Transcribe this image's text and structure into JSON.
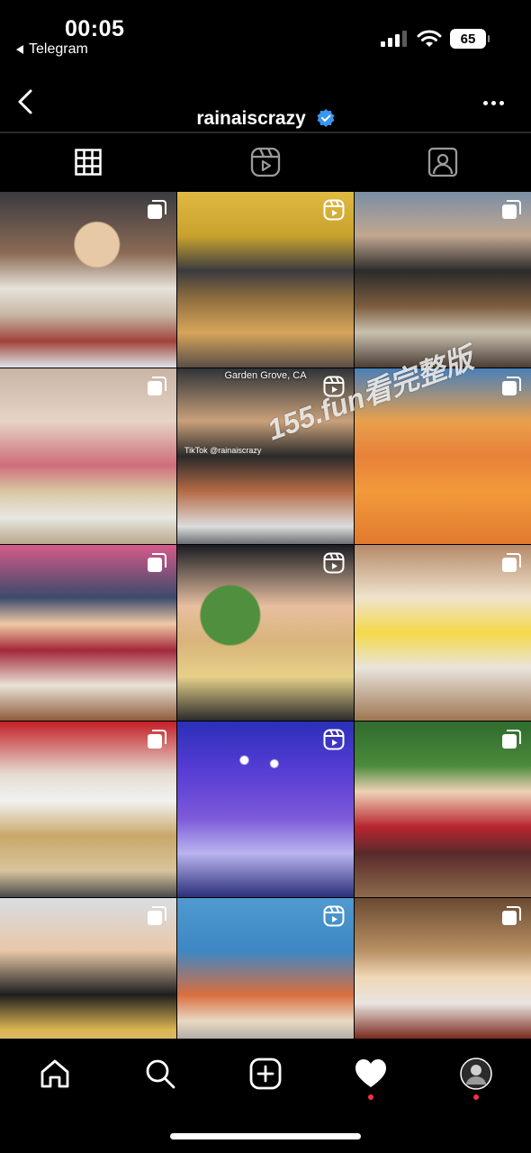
{
  "status_bar": {
    "time": "00:05",
    "back_app": "Telegram",
    "battery": "65"
  },
  "header": {
    "username": "rainaiscrazy",
    "verified": true
  },
  "tabs": [
    {
      "name": "posts-grid",
      "icon": "grid-icon",
      "active": true
    },
    {
      "name": "reels",
      "icon": "reels-icon",
      "active": false
    },
    {
      "name": "tagged",
      "icon": "tagged-person-icon",
      "active": false
    }
  ],
  "grid": {
    "posts": [
      {
        "overlay": "multiple-images-icon"
      },
      {
        "overlay": "reel-icon"
      },
      {
        "overlay": "multiple-images-icon"
      },
      {
        "overlay": "multiple-images-icon"
      },
      {
        "overlay": "reel-icon",
        "caption": "Garden Grove, CA",
        "tiktok_label": "TikTok @rainaiscrazy"
      },
      {
        "overlay": "multiple-images-icon"
      },
      {
        "overlay": "multiple-images-icon"
      },
      {
        "overlay": "reel-icon"
      },
      {
        "overlay": "multiple-images-icon"
      },
      {
        "overlay": "multiple-images-icon"
      },
      {
        "overlay": "reel-icon"
      },
      {
        "overlay": "multiple-images-icon"
      },
      {
        "overlay": "multiple-images-icon"
      },
      {
        "overlay": "reel-icon"
      },
      {
        "overlay": "multiple-images-icon"
      }
    ]
  },
  "watermark": "155.fun看完整版",
  "bottom_nav": [
    {
      "name": "home",
      "icon": "home-icon"
    },
    {
      "name": "search",
      "icon": "search-icon"
    },
    {
      "name": "create",
      "icon": "create-plus-icon"
    },
    {
      "name": "activity",
      "icon": "heart-icon",
      "notification_dot": true
    },
    {
      "name": "profile",
      "icon": "profile-avatar",
      "notification_dot": true
    }
  ],
  "colors": {
    "background": "#000000",
    "notification": "#ff3040",
    "verified": "#3897f0"
  }
}
